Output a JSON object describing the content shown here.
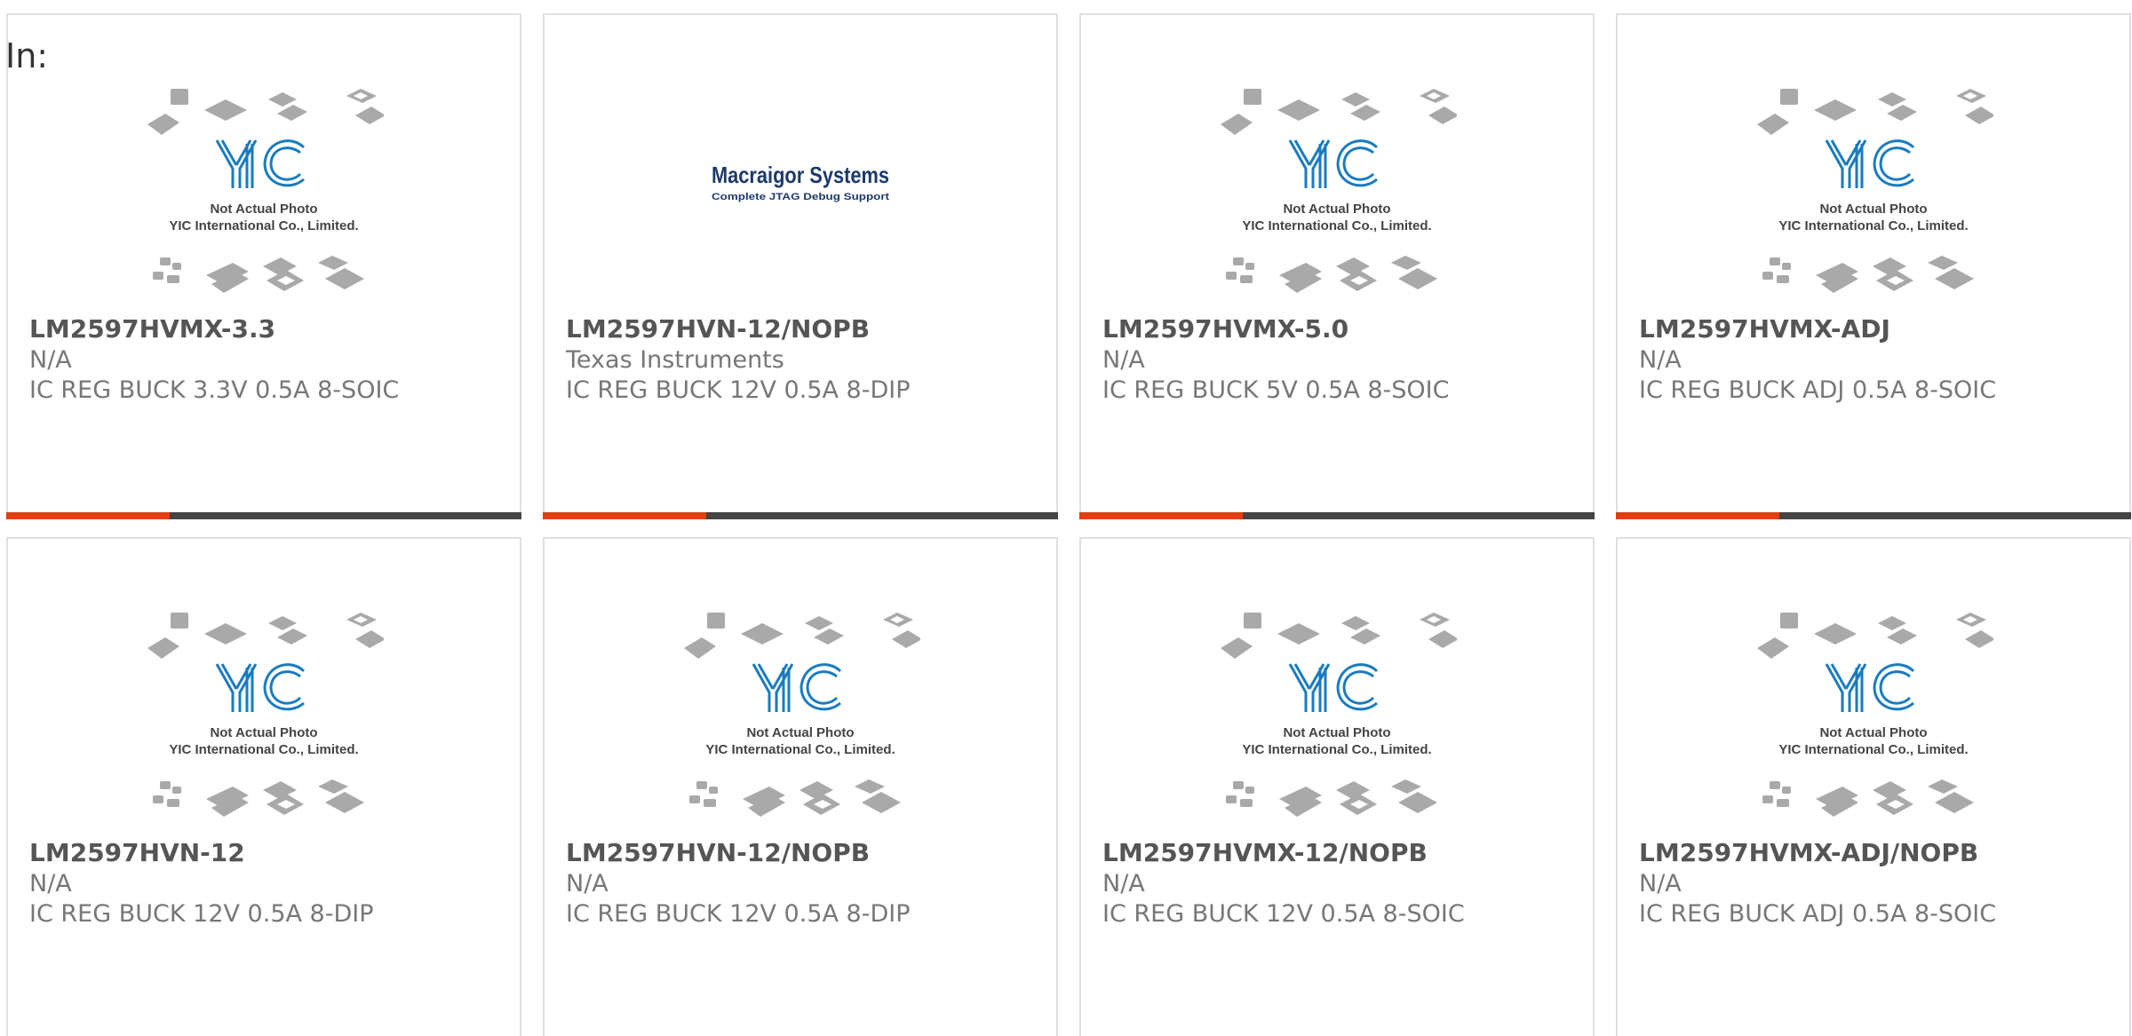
{
  "filter": {
    "label": "In:"
  },
  "theme": {
    "accent": "#e63c12",
    "bar_dark": "#444444",
    "card_border": "#e0e0e0"
  },
  "placeholder_image": {
    "line1": "Not Actual Photo",
    "line2": "YIC International Co., Limited.",
    "logo": "YIC"
  },
  "brand_image": {
    "name": "Macraigor Systems",
    "tagline": "Complete JTAG Debug Support"
  },
  "cards": [
    {
      "part": "LM2597HVMX-3.3",
      "manufacturer": "N/A",
      "description": "IC REG BUCK 3.3V 0.5A 8-SOIC",
      "image": "yic-placeholder"
    },
    {
      "part": "LM2597HVN-12/NOPB",
      "manufacturer": "Texas Instruments",
      "description": "IC REG BUCK 12V 0.5A 8-DIP",
      "image": "macraigor-logo"
    },
    {
      "part": "LM2597HVMX-5.0",
      "manufacturer": "N/A",
      "description": "IC REG BUCK 5V 0.5A 8-SOIC",
      "image": "yic-placeholder"
    },
    {
      "part": "LM2597HVMX-ADJ",
      "manufacturer": "N/A",
      "description": "IC REG BUCK ADJ 0.5A 8-SOIC",
      "image": "yic-placeholder"
    },
    {
      "part": "LM2597HVN-12",
      "manufacturer": "N/A",
      "description": "IC REG BUCK 12V 0.5A 8-DIP",
      "image": "yic-placeholder"
    },
    {
      "part": "LM2597HVN-12/NOPB",
      "manufacturer": "N/A",
      "description": "IC REG BUCK 12V 0.5A 8-DIP",
      "image": "yic-placeholder"
    },
    {
      "part": "LM2597HVMX-12/NOPB",
      "manufacturer": "N/A",
      "description": "IC REG BUCK 12V 0.5A 8-SOIC",
      "image": "yic-placeholder"
    },
    {
      "part": "LM2597HVMX-ADJ/NOPB",
      "manufacturer": "N/A",
      "description": "IC REG BUCK ADJ 0.5A 8-SOIC",
      "image": "yic-placeholder"
    }
  ]
}
